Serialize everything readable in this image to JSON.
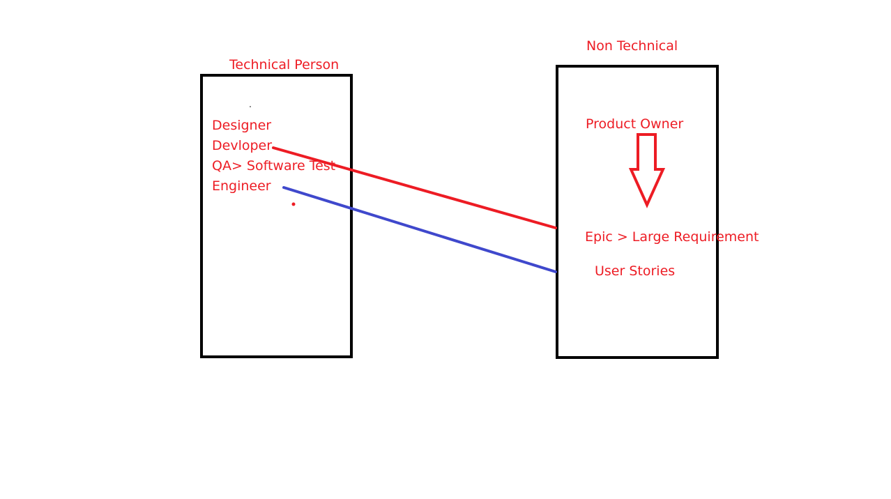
{
  "colors": {
    "text": "#ed1c24",
    "box_border": "#000000",
    "line_developer": "#ed1c24",
    "line_engineer": "#3f48cc",
    "arrow": "#ed1c24"
  },
  "left_box": {
    "title": "Technical Person",
    "roles": [
      "Designer",
      "Devloper",
      "QA> Software Test",
      "Engineer"
    ]
  },
  "right_box": {
    "title": "Non Technical",
    "owner": "Product Owner",
    "epic": "Epic > Large Requirement",
    "stories": "User Stories"
  },
  "connections": [
    {
      "from": "Devloper",
      "to": "Epic > Large Requirement",
      "color": "red"
    },
    {
      "from": "Engineer",
      "to": "User Stories",
      "color": "blue"
    }
  ],
  "arrow": {
    "from": "Product Owner",
    "to": "Epic > Large Requirement",
    "direction": "down"
  }
}
